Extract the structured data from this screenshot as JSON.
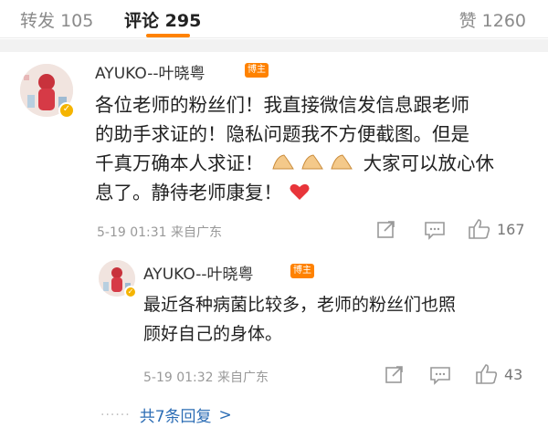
{
  "tabs": {
    "repost_label": "转发",
    "repost_count": "105",
    "comments_label": "评论",
    "comments_count": "295",
    "likes_label": "赞",
    "likes_count": "1260"
  },
  "comment": {
    "username": "AYUKO--叶晓粤",
    "badge": "博主",
    "lines": [
      "各位老师的粉丝们！我直接微信发信息跟老师",
      "的助手求证的！隐私问题我不方便截图。但是",
      "千真万确本人求证！",
      "大家可以放心休",
      "息了。静待老师康复！"
    ],
    "meta": "5-19 01:31 来自广东",
    "like_count": "167",
    "icons": [
      "share-icon",
      "comment-icon",
      "like-icon",
      "heart-emoji",
      "praying-hands-emoji",
      "verified-icon"
    ],
    "colors": {
      "badge": "#ff8200",
      "heart": "#e8353a",
      "verified": "#f5b400"
    }
  },
  "reply": {
    "username": "AYUKO--叶晓粤",
    "badge": "博主",
    "lines": [
      "最近各种病菌比较多，老师的粉丝们也照",
      "顾好自己的身体。"
    ],
    "meta": "5-19 01:32 来自广东",
    "like_count": "43"
  },
  "thread": {
    "dots": "······",
    "label": "共7条回复",
    "chevron": ">",
    "link_color": "#2c6db5"
  },
  "accent": "#ff8200"
}
